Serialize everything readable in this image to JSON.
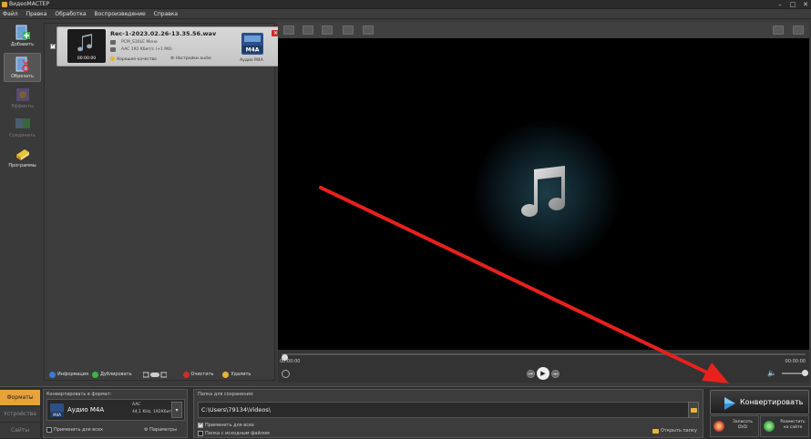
{
  "window": {
    "title": "ВидеоМАСТЕР"
  },
  "menu": [
    "Файл",
    "Правка",
    "Обработка",
    "Воспроизведение",
    "Справка"
  ],
  "toolbar": [
    {
      "label": "Добавить",
      "icon": "add-file-icon",
      "enabled": true
    },
    {
      "label": "Обрезать",
      "icon": "cut-icon",
      "enabled": true
    },
    {
      "label": "Эффекты",
      "icon": "effects-icon",
      "enabled": false
    },
    {
      "label": "Соединить",
      "icon": "join-icon",
      "enabled": false
    },
    {
      "label": "Программы",
      "icon": "programs-icon",
      "enabled": true
    }
  ],
  "file": {
    "name": "Rec-1-2023.02.26-13.35.56.wav",
    "codec1": "PCM_S16LE Моно",
    "codec2": "AAC 192 Kбит/с (+1 M6)",
    "duration": "00:00:00",
    "quality": "Хорошее качество",
    "sound_settings": "Настройки audio",
    "format_badge": "M4A",
    "format_label": "Аудио M4A",
    "checked": true
  },
  "file_bar": {
    "info": "Информация",
    "duplicate": "Дублировать",
    "clear": "Очистить",
    "delete": "Удалить"
  },
  "player": {
    "time_left": "00:00:00",
    "time_right": "00:00:00",
    "progress": 0,
    "volume": 1
  },
  "bottom": {
    "tabs": [
      "Форматы",
      "Устройства",
      "Сайты"
    ],
    "active_tab": 0,
    "convert_to_label": "Конвертировать в формат:",
    "format_name": "Аудио M4A",
    "format_icon_label": "M4A",
    "codec": "AAC",
    "params": "44,1 KHz, 192Кбит",
    "apply_all": "Применить для всех",
    "params_button": "Параметры",
    "save_folder_label": "Папка для сохранения:",
    "save_path": "C:\\Users\\79134\\Videos\\",
    "apply_all_2": "Применить для всех",
    "source_folder": "Папка с исходным файлом",
    "open_folder": "Открыть папку",
    "convert": "Конвертировать",
    "dvd_line1": "Записать",
    "dvd_line2": "DVD",
    "web_line1": "Разместить",
    "web_line2": "на сайте"
  },
  "colors": {
    "accent": "#e8a23a",
    "arrow": "#e8211d",
    "delete": "#c8302c"
  }
}
